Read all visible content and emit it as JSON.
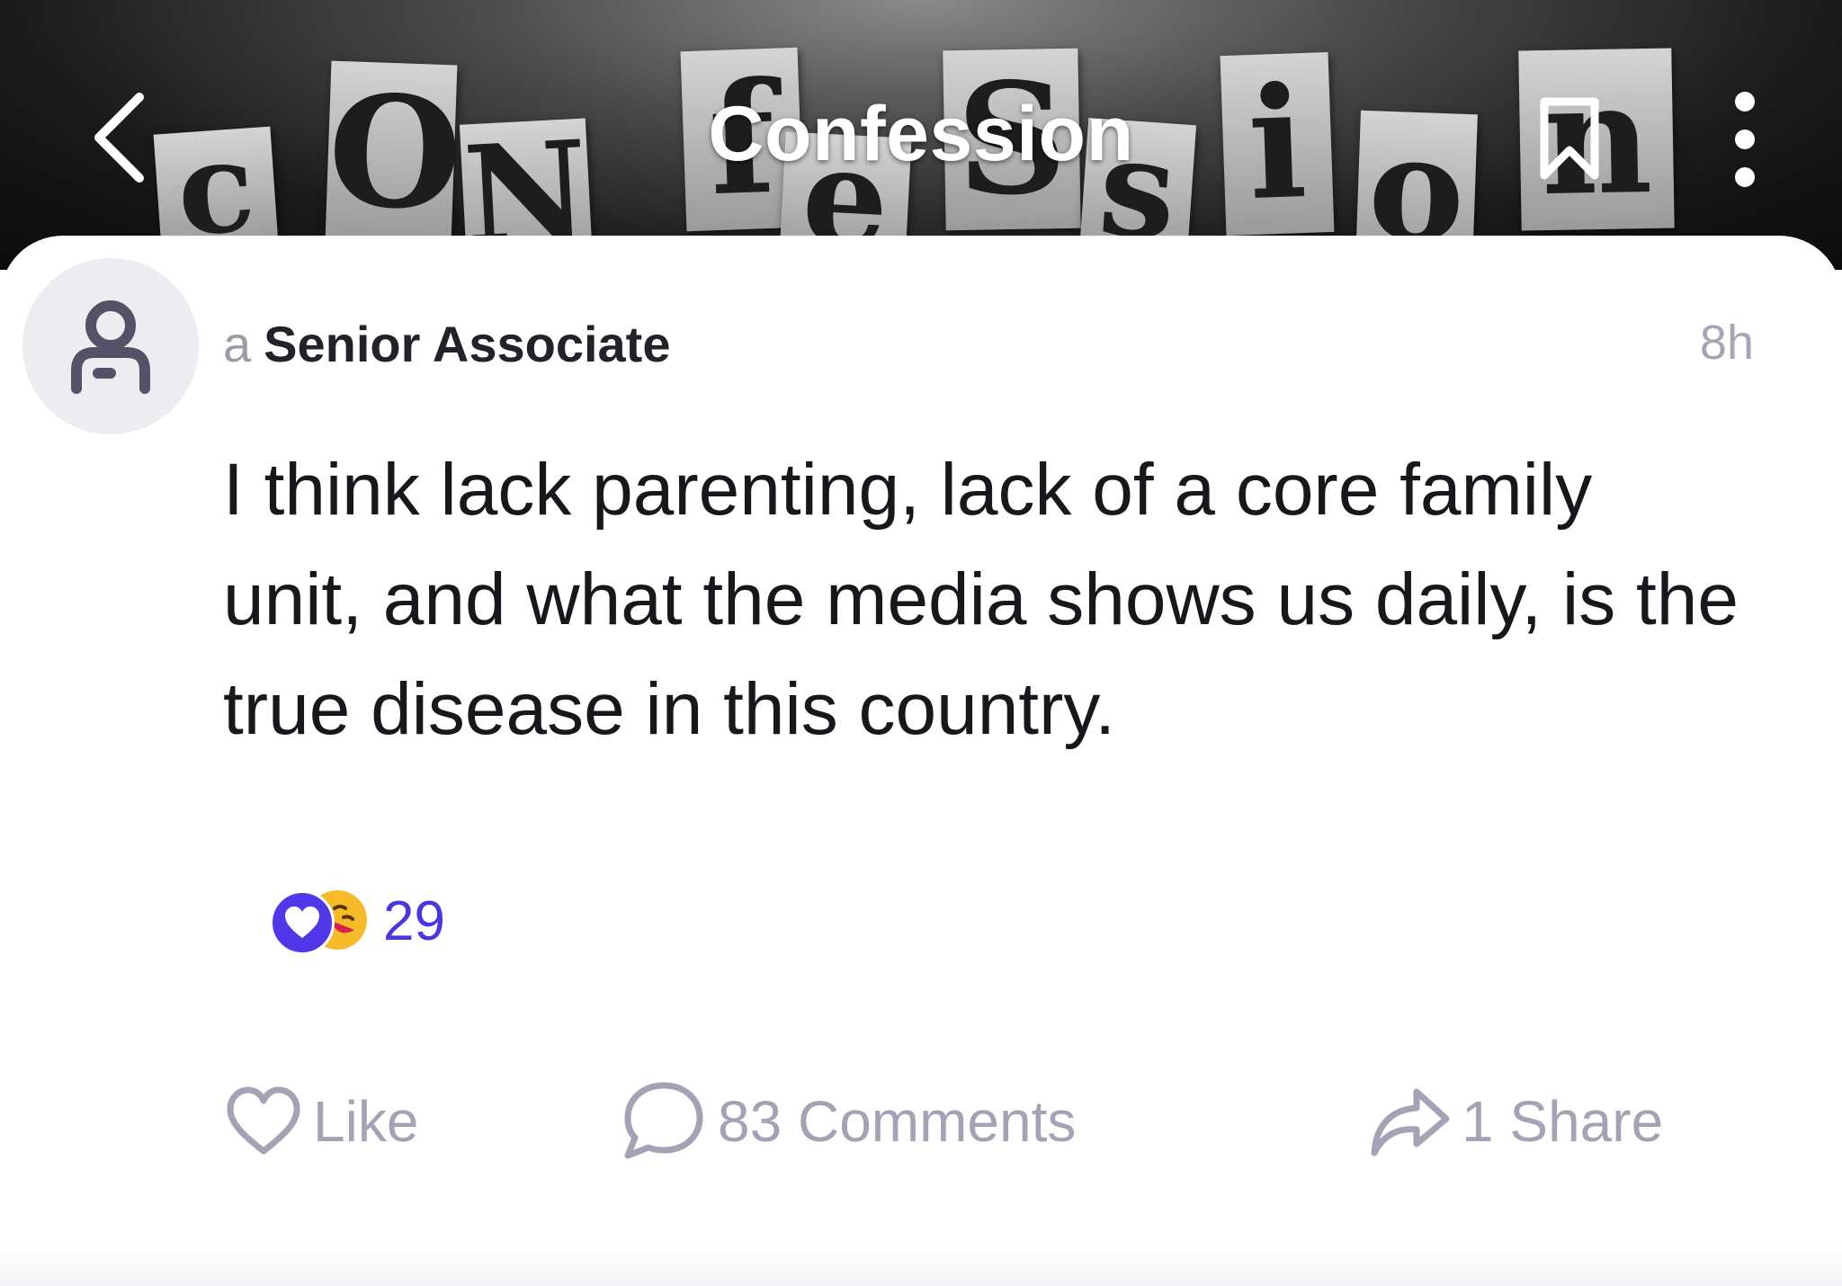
{
  "header": {
    "title": "Confession",
    "banner_letters": [
      "c",
      "O",
      "N",
      "f",
      "e",
      "S",
      "s",
      "i",
      "o",
      "n"
    ],
    "back_icon": "chevron-left-icon",
    "bookmark_icon": "bookmark-icon",
    "more_icon": "more-vertical-icon"
  },
  "post": {
    "author_prefix": "a",
    "author_role": "Senior Associate",
    "timestamp": "8h",
    "body": "I think lack parenting, lack of a core family unit, and what the media shows us daily, is the true disease in this country.",
    "reactions": {
      "count": "29",
      "icons": [
        "heart-reaction-icon",
        "laugh-reaction-icon"
      ]
    }
  },
  "actions": {
    "like_label": "Like",
    "comments_label": "83 Comments",
    "share_label": "1 Share"
  },
  "colors": {
    "accent": "#4a36e0",
    "muted": "#a6a2b6",
    "text": "#18181c"
  }
}
